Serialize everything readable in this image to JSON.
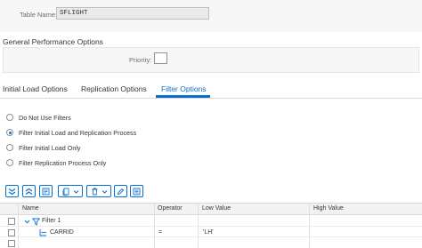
{
  "header": {
    "table_name_label": "Table Name:",
    "table_name_value": "SFLIGHT"
  },
  "performance": {
    "title": "General Performance Options",
    "priority_label": "Priority:",
    "priority_value": ""
  },
  "tabs": [
    {
      "label": "Initial Load Options",
      "active": false
    },
    {
      "label": "Replication Options",
      "active": false
    },
    {
      "label": "Filter Options",
      "active": true
    }
  ],
  "filter_options": [
    {
      "label": "Do Not Use Filters",
      "checked": false
    },
    {
      "label": "Filter Initial Load and Replication Process",
      "checked": true
    },
    {
      "label": "Filter Initial Load Only",
      "checked": false
    },
    {
      "label": "Filter Replication Process Only",
      "checked": false
    }
  ],
  "toolbar": {
    "icons": [
      "expand-all-icon",
      "collapse-all-icon",
      "expand-node-icon",
      "copy-icon",
      "dropdown-icon",
      "delete-icon",
      "dropdown-icon",
      "edit-icon",
      "details-icon",
      "duplicate-icon"
    ]
  },
  "grid": {
    "columns": [
      "Name",
      "Operator",
      "Low Value",
      "High Value"
    ],
    "rows": [
      {
        "name": "Filter 1",
        "operator": "",
        "low": "",
        "high": ""
      },
      {
        "name": "CARRID",
        "operator": "=",
        "low": "'LH'",
        "high": ""
      }
    ]
  },
  "colors": {
    "accent": "#0a6ed1",
    "text": "#32363a",
    "muted": "#6a6d70",
    "panel": "#f7f7f7"
  }
}
